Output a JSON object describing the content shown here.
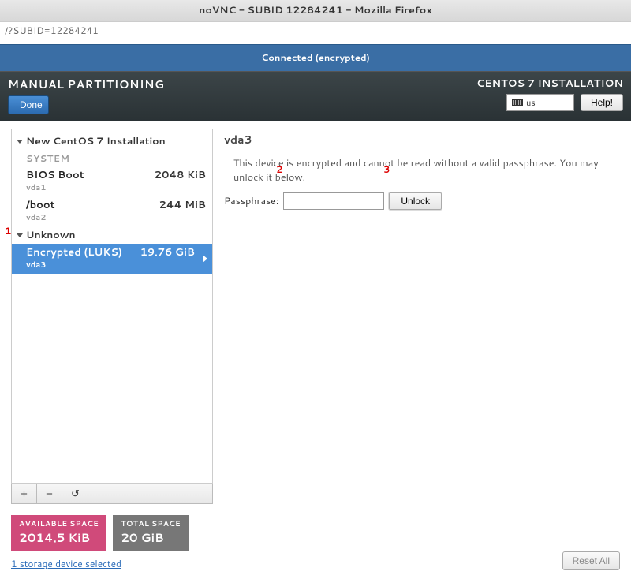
{
  "window": {
    "title": "noVNC - SUBID 12284241 - Mozilla Firefox",
    "url": "/?SUBID=12284241"
  },
  "vnc": {
    "status": "Connected (encrypted)"
  },
  "header": {
    "title": "MANUAL PARTITIONING",
    "done_label": "Done",
    "install_label": "CENTOS 7 INSTALLATION",
    "keyboard": "us",
    "help_label": "Help!"
  },
  "tree": {
    "section1": {
      "title": "New CentOS 7 Installation",
      "system": "SYSTEM"
    },
    "items": [
      {
        "name": "BIOS Boot",
        "dev": "vda1",
        "size": "2048 KiB"
      },
      {
        "name": "/boot",
        "dev": "vda2",
        "size": "244 MiB"
      }
    ],
    "section2": {
      "title": "Unknown"
    },
    "selected": {
      "name": "Encrypted (LUKS)",
      "dev": "vda3",
      "size": "19.76 GiB"
    }
  },
  "detail": {
    "heading": "vda3",
    "hint": "This device is encrypted and cannot be read without a valid passphrase. You may unlock it below.",
    "passphrase_label": "Passphrase:",
    "passphrase_value": "",
    "unlock_label": "Unlock"
  },
  "space": {
    "available": {
      "label": "AVAILABLE SPACE",
      "value": "2014.5 KiB"
    },
    "total": {
      "label": "TOTAL SPACE",
      "value": "20 GiB"
    }
  },
  "storage_link": "1 storage device selected",
  "reset_label": "Reset All",
  "annotations": {
    "a1": "1",
    "a2": "2",
    "a3": "3"
  }
}
